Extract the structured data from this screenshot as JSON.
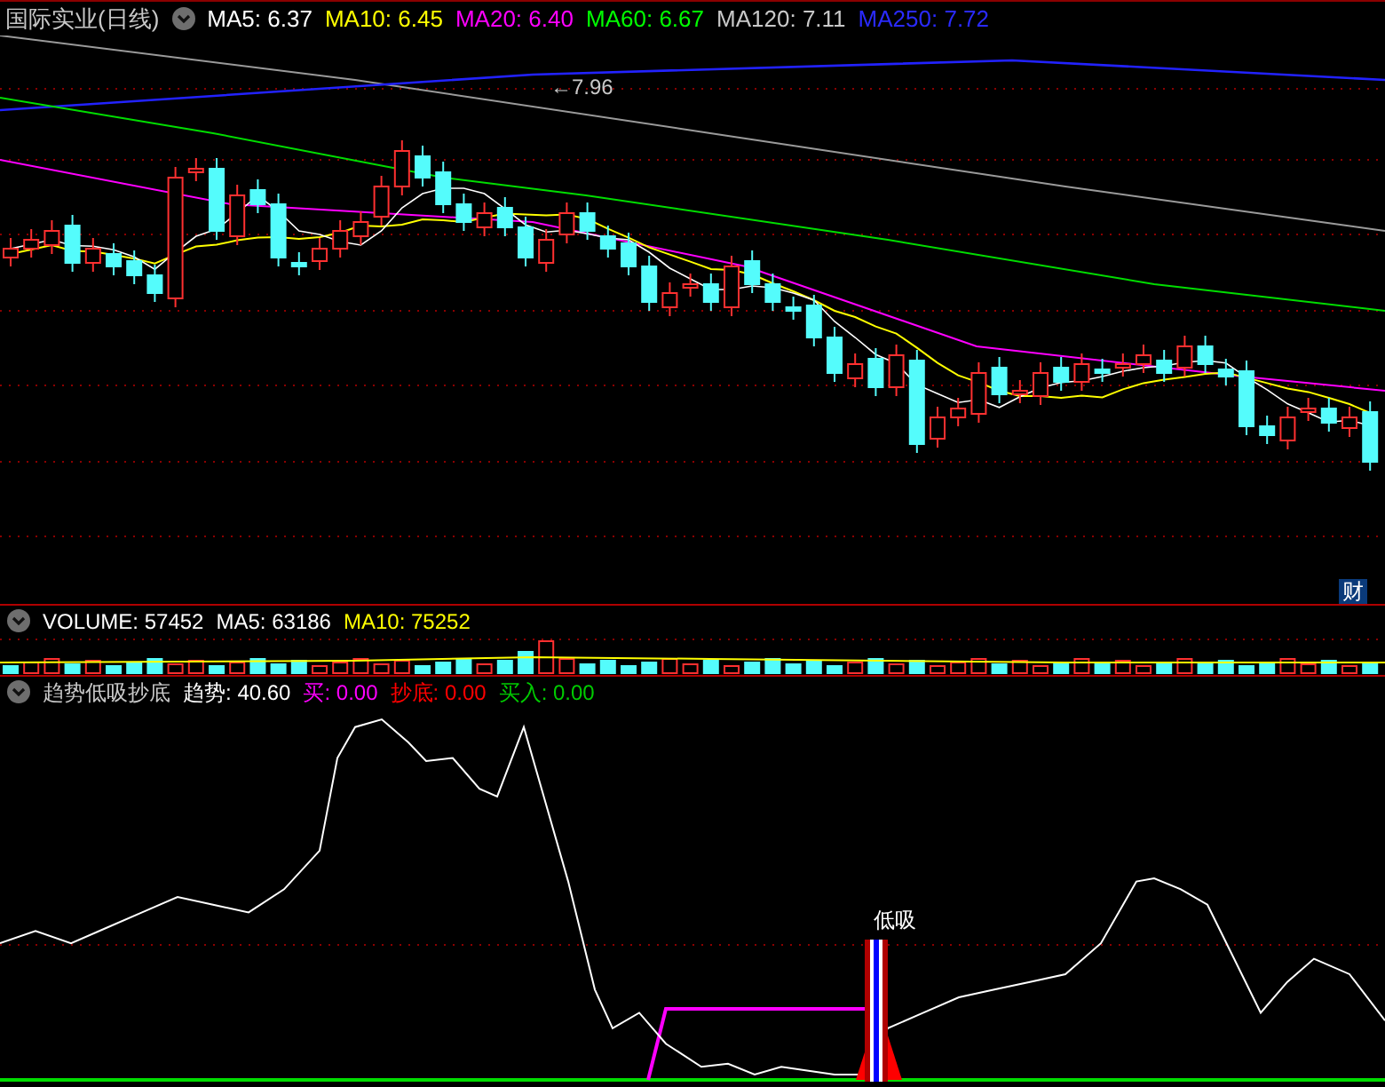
{
  "price_panel": {
    "title": "国际实业(日线)",
    "indicators": [
      {
        "label": "MA5:",
        "value": "6.37",
        "color": "#ffffff"
      },
      {
        "label": "MA10:",
        "value": "6.45",
        "color": "#ffff00"
      },
      {
        "label": "MA20:",
        "value": "6.40",
        "color": "#ff00ff"
      },
      {
        "label": "MA60:",
        "value": "6.67",
        "color": "#00ff00"
      },
      {
        "label": "MA120:",
        "value": "7.11",
        "color": "#c8c8c8"
      },
      {
        "label": "MA250:",
        "value": "7.72",
        "color": "#2a2aff"
      }
    ],
    "high_label": "←7.96",
    "badge": "财"
  },
  "volume_panel": {
    "indicators": [
      {
        "label": "VOLUME:",
        "value": "57452",
        "color": "#ffffff"
      },
      {
        "label": "MA5:",
        "value": "63186",
        "color": "#ffffff"
      },
      {
        "label": "MA10:",
        "value": "75252",
        "color": "#ffff00"
      }
    ]
  },
  "indicator_panel": {
    "title": "趋势低吸抄底",
    "indicators": [
      {
        "label": "趋势:",
        "value": "40.60",
        "color": "#ffffff"
      },
      {
        "label": "买:",
        "value": "0.00",
        "color": "#ff00ff"
      },
      {
        "label": "抄底:",
        "value": "0.00",
        "color": "#ff0000"
      },
      {
        "label": "买入:",
        "value": "0.00",
        "color": "#00cc00"
      }
    ],
    "signal_label": "低吸"
  }
}
